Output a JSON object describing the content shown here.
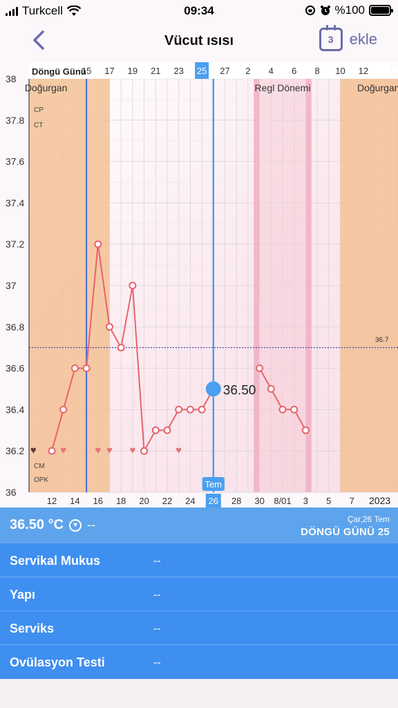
{
  "status_bar": {
    "carrier": "Turkcell",
    "time": "09:34",
    "battery": "%100"
  },
  "nav": {
    "title": "Vücut ısısı",
    "add_label": "ekle",
    "calendar_day": "3"
  },
  "chart": {
    "top_label": "Döngü Günü",
    "top_ticks": [
      "15",
      "17",
      "19",
      "21",
      "23",
      "25",
      "27",
      "2",
      "4",
      "6",
      "8",
      "10",
      "12"
    ],
    "top_ticks_slot": [
      3,
      5,
      7,
      9,
      11,
      13,
      15,
      17,
      19,
      21,
      23,
      25,
      27
    ],
    "bottom_ticks": [
      "12",
      "14",
      "16",
      "18",
      "20",
      "22",
      "24",
      "26",
      "28",
      "30",
      "8/01",
      "3",
      "5",
      "7"
    ],
    "bottom_ticks_slot": [
      0,
      2,
      4,
      6,
      8,
      10,
      12,
      14,
      16,
      18,
      20,
      22,
      24,
      26
    ],
    "year": "2023",
    "y_ticks": [
      "38",
      "37.8",
      "37.6",
      "37.4",
      "37.2",
      "37",
      "36.8",
      "36.6",
      "36.4",
      "36.2",
      "36"
    ],
    "ylim": [
      36,
      38
    ],
    "zones": {
      "fertile_left": "Doğurgan",
      "period": "Regl Dönemi",
      "fertile_right": "Doğurgan"
    },
    "side_labels": {
      "cp": "CP",
      "ct": "CT",
      "cm": "CM",
      "opk": "OPK"
    },
    "cover_line": "36.7",
    "cover_value": 36.7,
    "selected": {
      "top_label": "25",
      "bottom_month": "Tem",
      "bottom_day": "26",
      "value_label": "36.50"
    },
    "heart_slots": [
      -1,
      0,
      1,
      4,
      5,
      7,
      11
    ]
  },
  "chart_data": {
    "type": "line",
    "title": "Vücut ısısı",
    "x": [
      "12",
      "13",
      "14",
      "15",
      "16",
      "17",
      "18",
      "19",
      "20",
      "21",
      "22",
      "23",
      "24",
      "25",
      "26",
      "27",
      "28",
      "29",
      "30",
      "31",
      "8/01",
      "2",
      "3"
    ],
    "series": [
      {
        "values": [
          36.2,
          36.4,
          36.6,
          36.6,
          37.2,
          36.8,
          36.7,
          37.0,
          36.2,
          36.3,
          36.3,
          36.4,
          36.4,
          36.4,
          36.5,
          null,
          null,
          null,
          36.6,
          36.5,
          36.4,
          36.4,
          36.3
        ]
      }
    ],
    "ylim": [
      36,
      38
    ],
    "reference_line": 36.7,
    "selected_point": {
      "x": "26",
      "y": 36.5
    }
  },
  "summary": {
    "temp": "36.50 °C",
    "dash": "--",
    "date": "Çar,26 Tem",
    "cycle": "DÖNGÜ GÜNÜ 25"
  },
  "details": [
    {
      "label": "Servikal Mukus",
      "value": "--"
    },
    {
      "label": "Yapı",
      "value": "--"
    },
    {
      "label": "Serviks",
      "value": "--"
    },
    {
      "label": "Ovülasyon Testi",
      "value": "--"
    }
  ],
  "colors": {
    "line": "#e8636b",
    "fertile": "#f3c195",
    "period": "#f6c9d4",
    "accent": "#4a9ff0",
    "ovulation_line": "#3f6fd8"
  }
}
